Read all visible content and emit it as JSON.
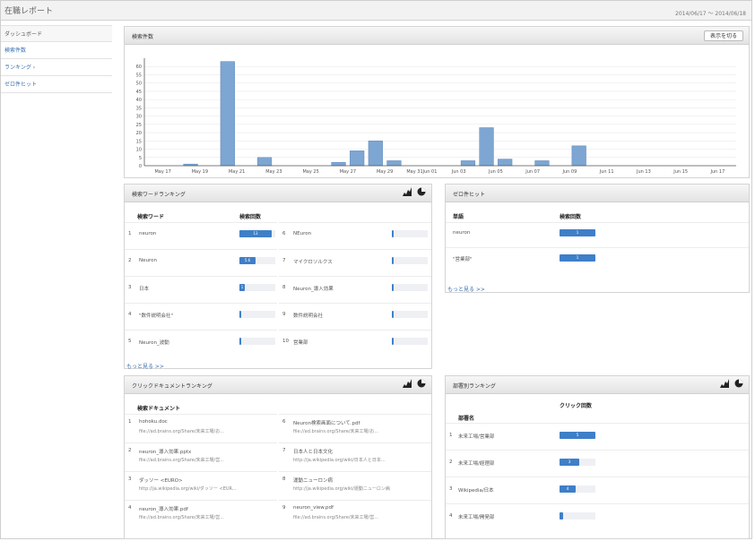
{
  "header": {
    "title": "在職レポート",
    "date_range": "2014/06/17 ～ 2014/06/18"
  },
  "sidebar": {
    "items": [
      {
        "label": "ダッシュボード"
      },
      {
        "label": "検索件数"
      },
      {
        "label": "ランキング ›"
      },
      {
        "label": "ゼロ件ヒット"
      }
    ]
  },
  "search_panel": {
    "title": "検索件数",
    "clear_button": "表示を切る"
  },
  "chart_data": {
    "type": "bar",
    "title": "検索件数",
    "ylim": [
      0,
      65
    ],
    "y_ticks": [
      "0",
      "5",
      "10",
      "15",
      "20",
      "25",
      "30",
      "35",
      "40",
      "45",
      "50",
      "55",
      "60"
    ],
    "x_tick_labels": [
      "May 17",
      "May 19",
      "May 21",
      "May 23",
      "May 25",
      "May 27",
      "May 29",
      "May 31Jun 01",
      "Jun 03",
      "Jun 05",
      "Jun 07",
      "Jun 09",
      "Jun 11",
      "Jun 13",
      "Jun 15",
      "Jun 17"
    ],
    "categories": [
      "May 17",
      "May 18",
      "May 19",
      "May 20",
      "May 21",
      "May 22",
      "May 23",
      "May 24",
      "May 25",
      "May 26",
      "May 27",
      "May 28",
      "May 29",
      "May 30",
      "May 31",
      "Jun 01",
      "Jun 02",
      "Jun 03",
      "Jun 04",
      "Jun 05",
      "Jun 06",
      "Jun 07",
      "Jun 08",
      "Jun 09",
      "Jun 10",
      "Jun 11",
      "Jun 12",
      "Jun 13",
      "Jun 14",
      "Jun 15",
      "Jun 16",
      "Jun 17"
    ],
    "values": [
      0,
      0,
      1,
      0,
      63,
      0,
      5,
      0,
      0,
      0,
      2,
      9,
      15,
      3,
      0,
      0,
      0,
      3,
      23,
      4,
      0,
      3,
      0,
      12,
      0,
      0,
      0,
      0,
      0,
      0,
      0,
      0
    ],
    "grid": true
  },
  "keyword_ranking": {
    "title": "検索ワードランキング",
    "col_word": "検索ワード",
    "col_count": "検索回数",
    "left": [
      {
        "rank": "1",
        "word": "neuron",
        "count": "13",
        "frac": 0.9
      },
      {
        "rank": "2",
        "word": "Neuron",
        "count": "5.6",
        "frac": 0.45
      },
      {
        "rank": "3",
        "word": "日本",
        "count": "1",
        "frac": 0.15
      },
      {
        "rank": "4",
        "word": "\"数件説明会社\"",
        "count": "",
        "frac": 0.05
      },
      {
        "rank": "5",
        "word": "Neuron_波動",
        "count": "",
        "frac": 0.05
      }
    ],
    "right": [
      {
        "rank": "6",
        "word": "NEuron",
        "count": "",
        "frac": 0.04
      },
      {
        "rank": "7",
        "word": "マイクロソルクス",
        "count": "",
        "frac": 0.04
      },
      {
        "rank": "8",
        "word": "Neuron_導入効果",
        "count": "",
        "frac": 0.04
      },
      {
        "rank": "9",
        "word": "数件説明会社",
        "count": "",
        "frac": 0.04
      },
      {
        "rank": "10",
        "word": "営業部",
        "count": "",
        "frac": 0.04
      }
    ],
    "more": "もっと見る >>"
  },
  "zero_hit": {
    "title": "ゼロ件ヒット",
    "col_word": "単語",
    "col_count": "検索回数",
    "rows": [
      {
        "word": "neuron",
        "count": "1",
        "frac": 1.0
      },
      {
        "word": "\"営業部\"",
        "count": "1",
        "frac": 1.0
      }
    ],
    "more": "もっと見る >>"
  },
  "click_doc_ranking": {
    "title": "クリックドキュメントランキング",
    "col_doc": "検索ドキュメント",
    "left": [
      {
        "rank": "1",
        "name": "hohoku.doc",
        "path": "file://ad.brains.org/Share/未来工場/お..."
      },
      {
        "rank": "2",
        "name": "neuron_導入効果.pptx",
        "path": "file://ad.brains.org/Share/未来工場/営..."
      },
      {
        "rank": "3",
        "name": "ダッソー <EURO>",
        "path": "http://ja.wikipedia.org/wiki/ダッソー <EUR..."
      },
      {
        "rank": "4",
        "name": "neuron_導入効果.pdf",
        "path": "file://ad.brains.org/Share/未来工場/営..."
      }
    ],
    "right": [
      {
        "rank": "6",
        "name": "Neuron検索画面について.pdf",
        "path": "file://ad.brains.org/Share/未来工場/お..."
      },
      {
        "rank": "7",
        "name": "日本人と日本文化",
        "path": "http://ja.wikipedia.org/wiki/日本人と日本..."
      },
      {
        "rank": "8",
        "name": "運動ニューロン病",
        "path": "http://ja.wikipedia.org/wiki/運動ニューロン病"
      },
      {
        "rank": "9",
        "name": "neuron_view.pdf",
        "path": "file://ad.brains.org/Share/未来工場/営..."
      }
    ]
  },
  "dept_ranking": {
    "title": "部署別ランキング",
    "col_dept": "部署名",
    "col_count": "クリック回数",
    "rows": [
      {
        "rank": "1",
        "name": "未来工場/営業部",
        "count": "5",
        "frac": 1.0
      },
      {
        "rank": "2",
        "name": "未来工場/経理部",
        "count": "3",
        "frac": 0.55
      },
      {
        "rank": "3",
        "name": "Wikipedia/日本",
        "count": "4",
        "frac": 0.45
      },
      {
        "rank": "4",
        "name": "未来工場/開発部",
        "count": "",
        "frac": 0.1
      }
    ]
  }
}
